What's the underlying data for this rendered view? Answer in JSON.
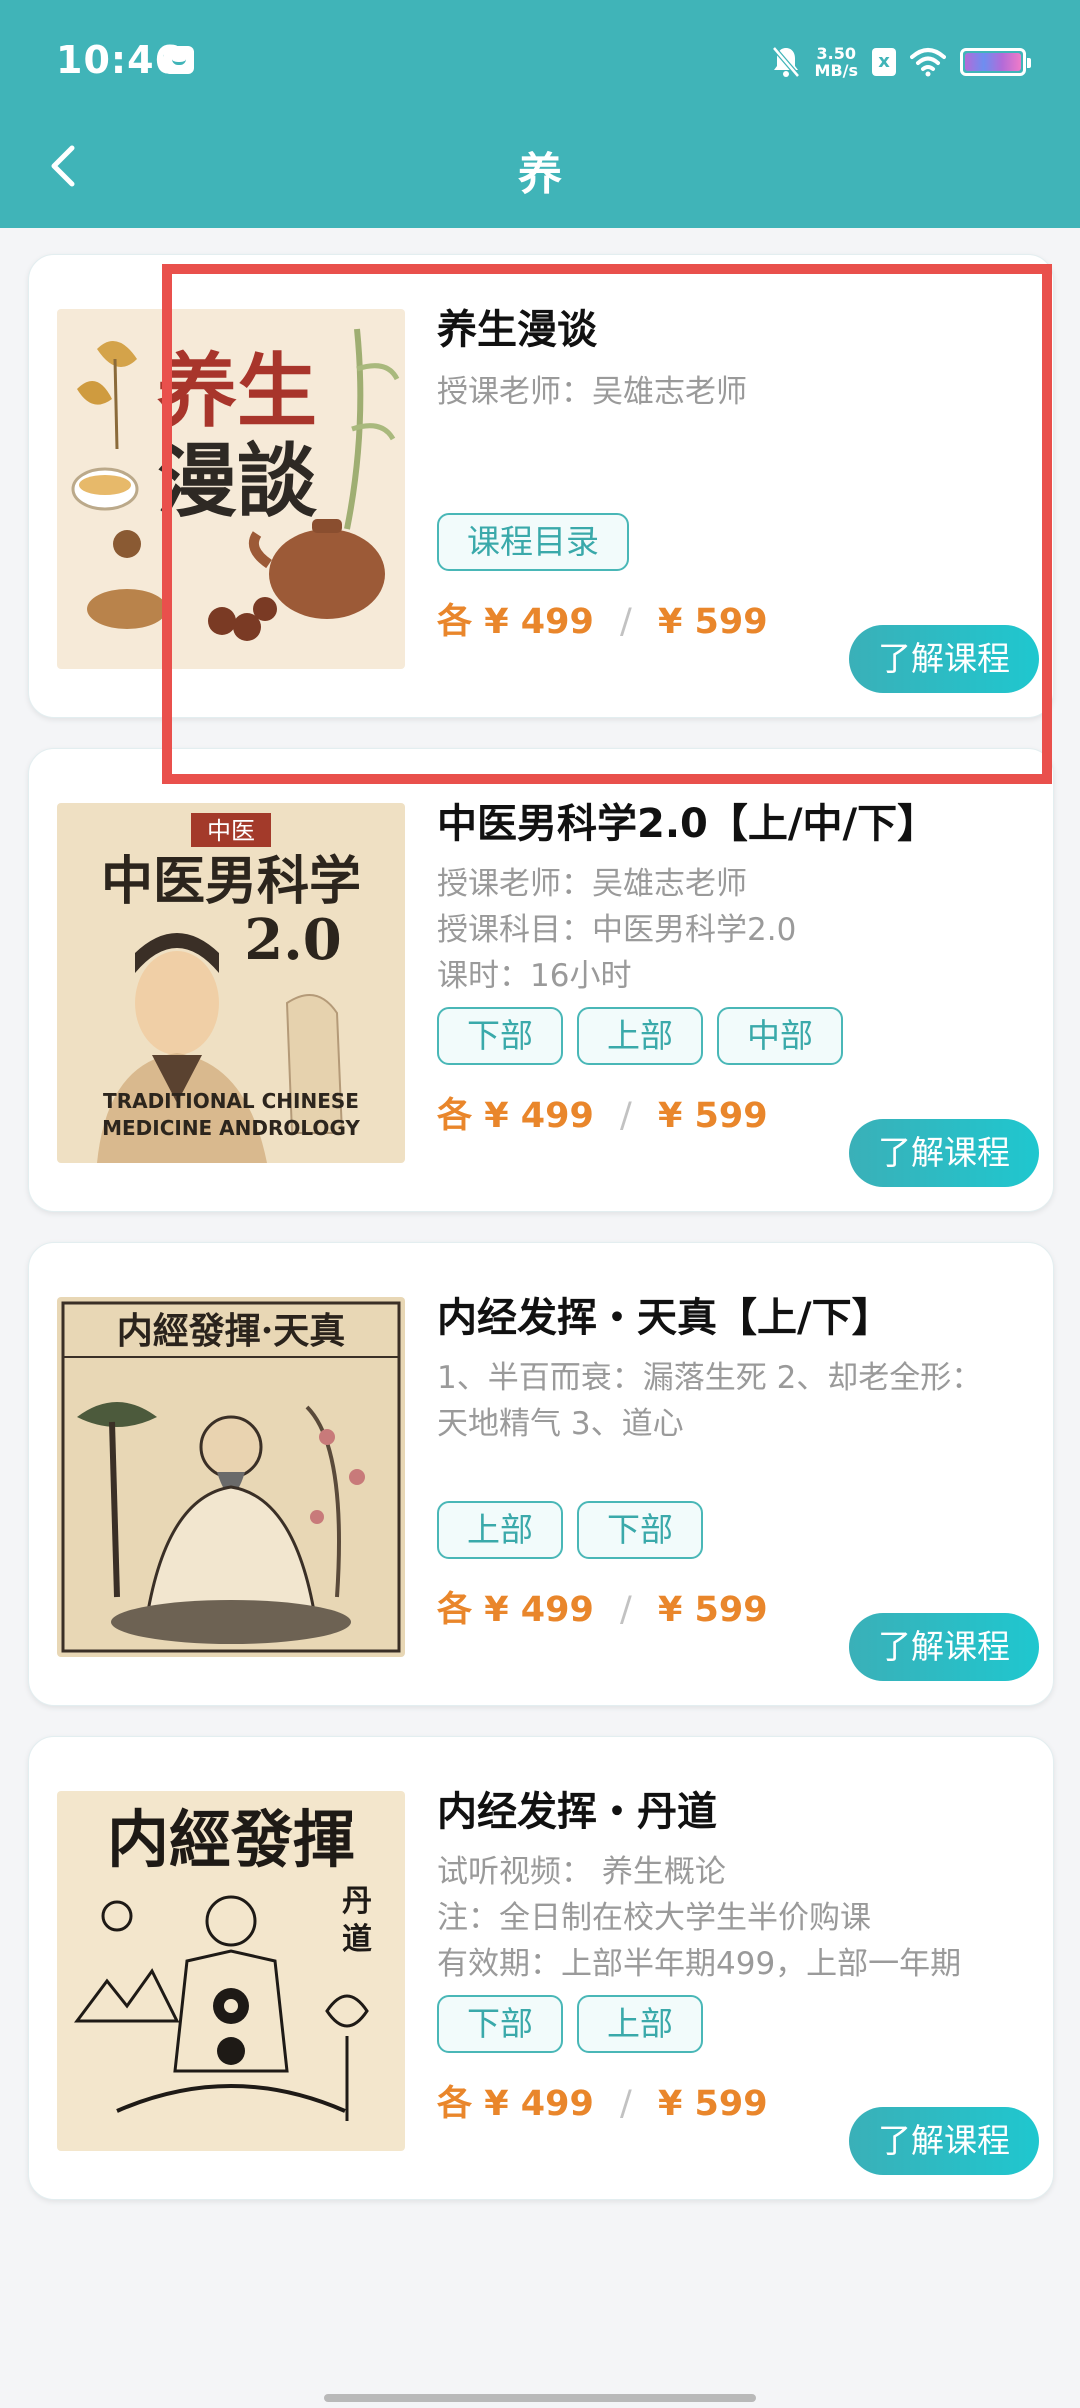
{
  "status_bar": {
    "time": "10:46",
    "speed_value": "3.50",
    "speed_unit": "MB/s",
    "sim_label": "x",
    "icons": [
      "notification-icon",
      "bell-off-icon",
      "sim-icon",
      "wifi-icon",
      "battery-icon"
    ]
  },
  "header": {
    "title": "养",
    "back_icon": "chevron-left-icon"
  },
  "colors": {
    "header": "#40b4b8",
    "price": "#e9862b",
    "tag_border": "#49b7b7",
    "button": "#1fc7cf",
    "highlight": "#e9504c"
  },
  "courses": [
    {
      "title": "养生漫谈",
      "info": [
        "授课老师：吴雄志老师"
      ],
      "tags": [
        "课程目录"
      ],
      "price_prefix": "各",
      "price_a": "¥ 499",
      "price_sep": "/",
      "price_b": "¥ 599",
      "button": "了解课程",
      "cover": {
        "lines": [
          "养生",
          "漫談"
        ]
      }
    },
    {
      "title": "中医男科学2.0【上/中/下】",
      "info": [
        "授课老师：吴雄志老师",
        "授课科目：中医男科学2.0",
        "课时：16小时"
      ],
      "tags": [
        "下部",
        "上部",
        "中部"
      ],
      "price_prefix": "各",
      "price_a": "¥ 499",
      "price_sep": "/",
      "price_b": "¥ 599",
      "button": "了解课程",
      "cover": {
        "badge": "中医",
        "lines": [
          "中医男科学",
          "2.0"
        ],
        "subtitle": [
          "TRADITIONAL CHINESE",
          "MEDICINE ANDROLOGY"
        ]
      }
    },
    {
      "title": "内经发挥・天真【上/下】",
      "info": [
        "1、半百而衰：漏落生死 2、却老全形：",
        "天地精气 3、道心"
      ],
      "tags": [
        "上部",
        "下部"
      ],
      "price_prefix": "各",
      "price_a": "¥ 499",
      "price_sep": "/",
      "price_b": "¥ 599",
      "button": "了解课程",
      "cover": {
        "lines": [
          "内經發揮·天真"
        ]
      }
    },
    {
      "title": "内经发挥・丹道",
      "info": [
        "试听视频： 养生概论",
        "注：全日制在校大学生半价购课",
        "有效期：上部半年期499，上部一年期"
      ],
      "tags": [
        "下部",
        "上部"
      ],
      "price_prefix": "各",
      "price_a": "¥ 499",
      "price_sep": "/",
      "price_b": "¥ 599",
      "button": "了解课程",
      "cover": {
        "lines": [
          "内經發揮",
          "丹",
          "道"
        ]
      }
    }
  ]
}
